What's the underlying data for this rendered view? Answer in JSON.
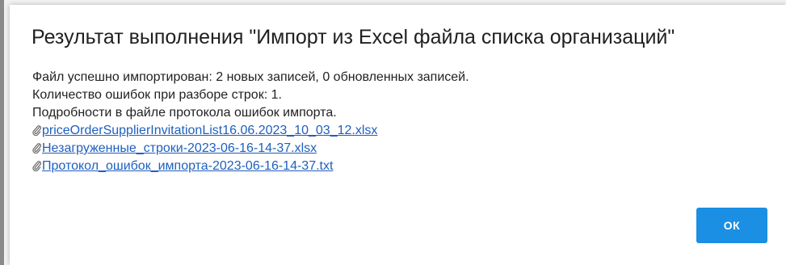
{
  "dialog": {
    "title": "Результат выполнения \"Импорт из Excel файла списка организаций\"",
    "messages": [
      "Файл успешно импортирован: 2 новых записей, 0 обновленных записей.",
      "Количество ошибок при разборе строк: 1.",
      "Подробности в файле протокола ошибок импорта."
    ],
    "files": [
      {
        "name": "priceOrderSupplierInvitationList16.06.2023_10_03_12.xlsx",
        "icon": "paperclip-icon"
      },
      {
        "name": "Незагруженные_строки-2023-06-16-14-37.xlsx",
        "icon": "paperclip-icon"
      },
      {
        "name": "Протокол_ошибок_импорта-2023-06-16-14-37.txt",
        "icon": "paperclip-icon"
      }
    ],
    "ok_label": "ОК"
  },
  "colors": {
    "link": "#1f5fbf",
    "ok_button": "#1a8fe3",
    "title_text": "#202020"
  }
}
